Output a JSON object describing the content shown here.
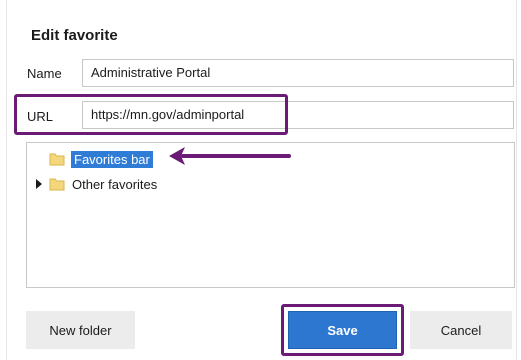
{
  "dialog": {
    "title": "Edit favorite",
    "name_label": "Name",
    "name_value": "Administrative Portal",
    "url_label": "URL",
    "url_value": "https://mn.gov/adminportal"
  },
  "tree": {
    "items": [
      {
        "label": "Favorites bar",
        "selected": true,
        "icon": "folder-icon"
      },
      {
        "label": "Other favorites",
        "selected": false,
        "icon": "folder-icon",
        "expandable": true
      }
    ]
  },
  "buttons": {
    "new_folder": "New folder",
    "save": "Save",
    "cancel": "Cancel"
  },
  "colors": {
    "annotation": "#6b1a75",
    "selection": "#2f7cd6",
    "primary_button": "#2e77d0",
    "folder": "#f5d77b"
  }
}
